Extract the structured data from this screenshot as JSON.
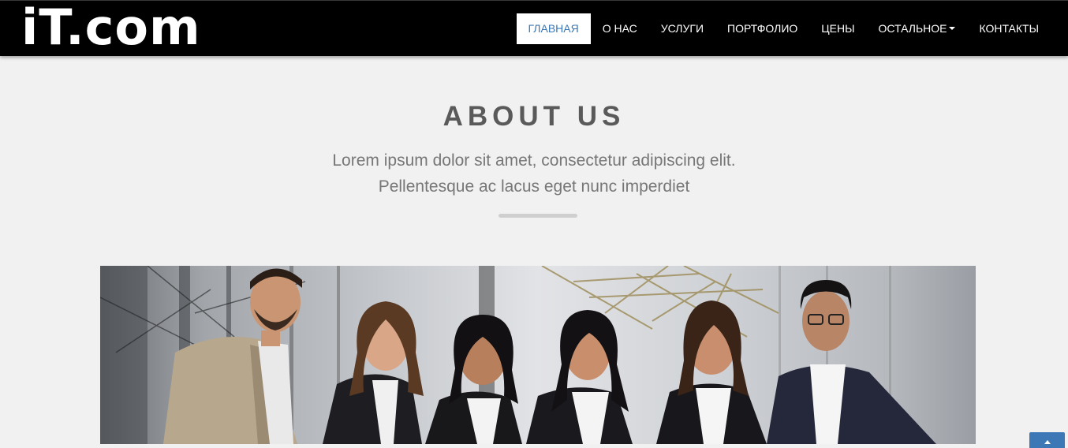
{
  "header": {
    "logo_text": "iT.com",
    "nav": [
      {
        "label": "ГЛАВНАЯ",
        "active": true
      },
      {
        "label": "О НАС"
      },
      {
        "label": "УСЛУГИ"
      },
      {
        "label": "ПОРТФОЛИО"
      },
      {
        "label": "ЦЕНЫ"
      },
      {
        "label": "ОСТАЛЬНОЕ",
        "dropdown": true
      },
      {
        "label": "КОНТАКТЫ"
      }
    ]
  },
  "about": {
    "title": "ABOUT US",
    "subtitle_line1": "Lorem ipsum dolor sit amet, consectetur adipiscing elit.",
    "subtitle_line2": "Pellentesque ac lacus eget nunc imperdiet"
  },
  "colors": {
    "nav_bg": "#000000",
    "active_link": "#3b78b5",
    "page_bg": "#f1f1f1",
    "scroll_button": "#3b78b5"
  },
  "icons": {
    "dropdown": "caret-down-icon",
    "scroll_top": "arrow-up-icon"
  }
}
